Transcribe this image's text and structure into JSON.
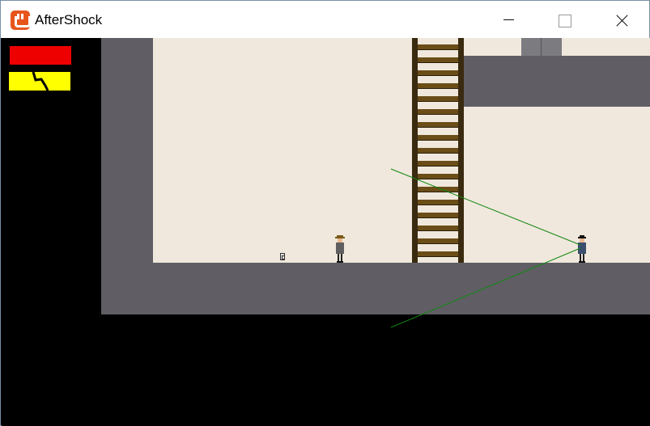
{
  "window": {
    "title": "AfterShock",
    "icon": "monogame-icon",
    "controls": [
      "minimize-icon",
      "maximize-icon",
      "close-icon"
    ]
  },
  "colors": {
    "background": "#000000",
    "wall": "#605e64",
    "room": "#f0e8dc",
    "health": "#ee0000",
    "shock": "#ffff00",
    "ladder_rail": "#3a2a10",
    "ladder_rung": "#6b4d18",
    "sight_line": "#118811"
  },
  "hud": {
    "health_bar": {
      "icon": "health-bar",
      "level": 1.0
    },
    "shock_bar": {
      "icon": "lightning-bolt-icon",
      "level": 1.0
    }
  },
  "entities": {
    "player": {
      "icon": "player-sprite"
    },
    "guard": {
      "icon": "guard-sprite"
    },
    "pickup": {
      "icon": "keycard-icon"
    },
    "ladder": {
      "icon": "ladder"
    }
  }
}
